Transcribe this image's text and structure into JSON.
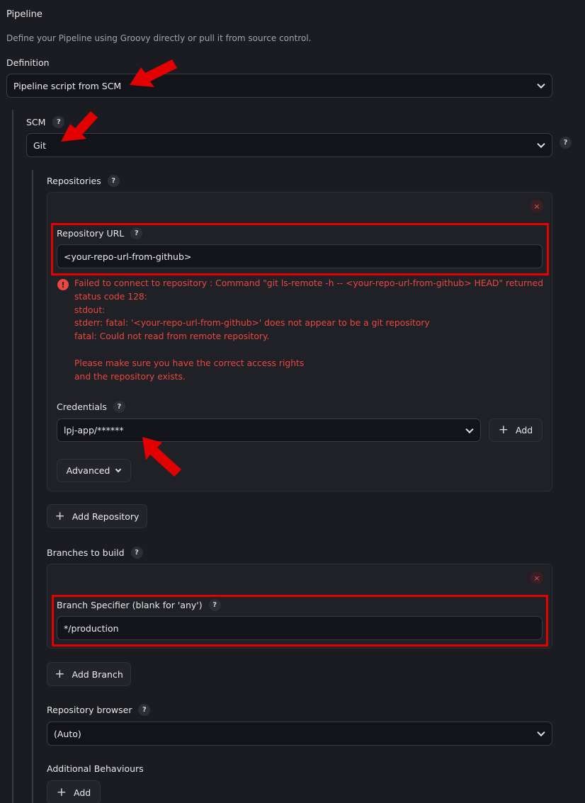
{
  "pipeline": {
    "heading": "Pipeline",
    "description": "Define your Pipeline using Groovy directly or pull it from source control.",
    "definition_label": "Definition",
    "definition_value": "Pipeline script from SCM"
  },
  "scm": {
    "label": "SCM",
    "value": "Git"
  },
  "repositories": {
    "label": "Repositories",
    "url_label": "Repository URL",
    "url_value": "<your-repo-url-from-github>",
    "error_lines": [
      "Failed to connect to repository : Command \"git ls-remote -h -- <your-repo-url-from-github> HEAD\" returned",
      "status code 128:",
      "stdout:",
      "stderr: fatal: '<your-repo-url-from-github>' does not appear to be a git repository",
      "fatal: Could not read from remote repository.",
      "",
      "Please make sure you have the correct access rights",
      "and the repository exists."
    ],
    "credentials_label": "Credentials",
    "credentials_value": "lpj-app/******",
    "add_label": "Add",
    "advanced_label": "Advanced",
    "add_repository_label": "Add Repository"
  },
  "branches": {
    "label": "Branches to build",
    "specifier_label": "Branch Specifier (blank for 'any')",
    "specifier_value": "*/production",
    "add_branch_label": "Add Branch"
  },
  "repo_browser": {
    "label": "Repository browser",
    "value": "(Auto)"
  },
  "behaviours": {
    "label": "Additional Behaviours",
    "add_label": "Add"
  },
  "icons": {
    "help": "?",
    "close": "×",
    "error": "!",
    "plus": "+"
  },
  "colors": {
    "background": "#1b1c21",
    "panel": "#202127",
    "error": "#e8483f",
    "annotation": "#e20000"
  }
}
